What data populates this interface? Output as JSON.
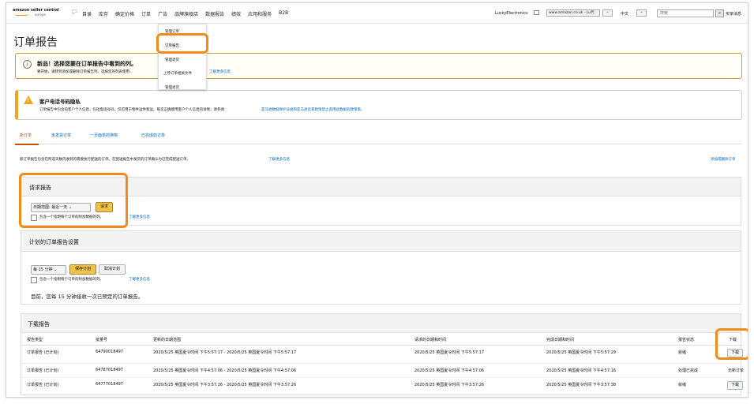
{
  "brand": {
    "logo_line1": "amazon seller central",
    "logo_line2": "europe"
  },
  "nav": {
    "flag": "🏳",
    "items": [
      "目录",
      "库存",
      "确定价格",
      "订单",
      "广告",
      "品牌旗舰店",
      "数据报告",
      "绩效",
      "应用和服务",
      "B2B"
    ],
    "store": "LuckyElectronics",
    "marketplace": "www.amazon.co.uk - Lu代",
    "language": "中文",
    "search_placeholder": "搜索",
    "search_icon": "magnifier-icon",
    "messages": "买家消息"
  },
  "orders_menu": [
    "管理订单",
    "订单报告",
    "管理退货",
    "上传订单相关文件",
    "管理退货"
  ],
  "page_title": "订单报告",
  "notice1": {
    "title": "新品！选择您要在订单报告中看到的列。",
    "text": "要开始，请转到添加或删除订单报告列，选择您的列表使用...",
    "link": "了解更多信息"
  },
  "notice2": {
    "title": "客户电话号码隐私",
    "text": "订单报告中包含的客户个人信息，包括电话号码，仅可用于物件运件和运。每次正确使用客户个人信息的详情，请参阅",
    "link": "亚马逊数据保护法规和亚马逊卖家政策禁止滥用此数据的政策策。"
  },
  "tabs": [
    "新订单",
    "未发货订单",
    "一页面单的换物",
    "已完成的订单"
  ],
  "intro": {
    "text": "新订单报告包含在所选天数内收到的需要执行配送的订单。在配送报告中发货的订单确认为已完成配送订单。",
    "link": "了解更多信息",
    "right_link": "添加或删除订单"
  },
  "request": {
    "title": "请求报告",
    "range": "日期范围: 最近一天",
    "button": "请求",
    "checkbox": "包含一个指明每个订单的附加数据的列。",
    "link": "了解更多信息"
  },
  "schedule": {
    "title": "计划的订单报告设置",
    "interval": "每 15 分钟",
    "save": "保存计划",
    "cancel": "取消计划",
    "checkbox": "包含一个指明每个订单的附加数据的列。",
    "link": "了解更多信息",
    "status": "目前，您每 15 分钟接收一次已预定的订单报告。"
  },
  "download": {
    "title": "下载报告",
    "columns": [
      "报告类型",
      "批量号",
      "更新的日期范围",
      "请求的日期和时间",
      "完成日期和时间",
      "报告状态",
      "下载"
    ],
    "rows": [
      {
        "type": "订单报告 (已计划)",
        "batch": "64790018497",
        "range": "2020/5/25 英国夏令时间 下午5:57:17 - 2020/5/25 英国夏令时间 下午5:57:17",
        "requested": "2020/5/25 英国夏令时间 下午5:57:17",
        "completed": "2020/5/25 英国夏令时间 下午5:57:29",
        "status": "就绪",
        "action": "下载"
      },
      {
        "type": "订单报告 (已计划)",
        "batch": "64787018497",
        "range": "2020/5/25 英国夏令时间 下午4:57:06 - 2020/5/25 英国夏令时间 下午4:57:06",
        "requested": "2020/5/25 英国夏令时间 下午4:57:06",
        "completed": "2020/5/25 英国夏令时间 下午4:57:16",
        "status": "处理已完成",
        "action": "无新订单"
      },
      {
        "type": "订单报告 (已计划)",
        "batch": "64777018497",
        "range": "2020/5/25 英国夏令时间 下午3:57:26 - 2020/5/25 英国夏令时间 下午3:57:26",
        "requested": "2020/5/25 英国夏令时间 下午3:57:26",
        "completed": "2020/5/25 英国夏令时间 下午3:57:38",
        "status": "就绪",
        "action": "下载"
      }
    ]
  },
  "colors": {
    "accent": "#f08c1a",
    "link": "#0066c0",
    "button_yellow": "#f0c14b",
    "info_border": "#c9a227",
    "warn": "#f1a420"
  }
}
